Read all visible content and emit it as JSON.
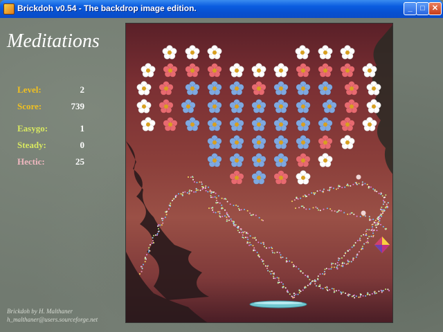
{
  "window": {
    "title": "Brickdoh v0.54 - The backdrop image edition.",
    "buttons": [
      "minimize",
      "maximize",
      "close"
    ]
  },
  "sidebar": {
    "heading": "Meditations",
    "stats": [
      {
        "label": "Level:",
        "value": "2",
        "color": "#f0c020"
      },
      {
        "label": "Score:",
        "value": "739",
        "color": "#f0c020"
      },
      {
        "label": "Easygo:",
        "value": "1",
        "color": "#d8e860"
      },
      {
        "label": "Steady:",
        "value": "0",
        "color": "#d8e860"
      },
      {
        "label": "Hectic:",
        "value": "25",
        "color": "#f0b8c0"
      }
    ],
    "credit_line1": "Brickdoh by H. Malthaner",
    "credit_line2": "h_malthaner@users.sourceforge.net"
  },
  "colors": {
    "flower_white": "#ffffff",
    "flower_red": "#e86a70",
    "flower_blue": "#7fa8e0",
    "flower_center": "#d8a020",
    "paddle": "#70c8d0"
  },
  "bricks": {
    "rows": [
      [
        0,
        0,
        0,
        0,
        0,
        0,
        0,
        0,
        0,
        0,
        0,
        0,
        0
      ],
      [
        0,
        0,
        0,
        0,
        0,
        0,
        0,
        0,
        0,
        0,
        0,
        0,
        0
      ]
    ]
  }
}
